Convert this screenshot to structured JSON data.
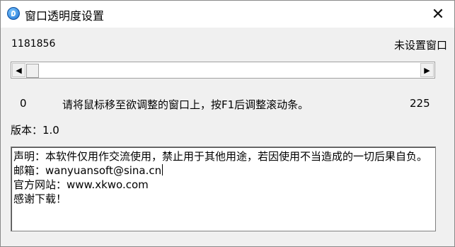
{
  "window": {
    "title": "窗口透明度设置",
    "close_glyph": "✕"
  },
  "handle_value": "1181856",
  "target_status": "未设置窗口",
  "slider": {
    "min_label": "0",
    "max_label": "225",
    "value": 0,
    "left_arrow": "◀",
    "right_arrow": "▶"
  },
  "hint": "请将鼠标移至欲调整的窗口上，按F1后调整滚动条。",
  "version": "版本：1.0",
  "info_lines": [
    "声明：本软件仅用作交流使用，禁止用于其他用途，若因使用不当造成的一切后果自负。",
    "邮箱：wanyuansoft@sina.cn",
    "官方网站：www.xkwo.com",
    "感谢下载！"
  ],
  "icons": {
    "app": "app-logo-icon",
    "close": "close-icon"
  }
}
